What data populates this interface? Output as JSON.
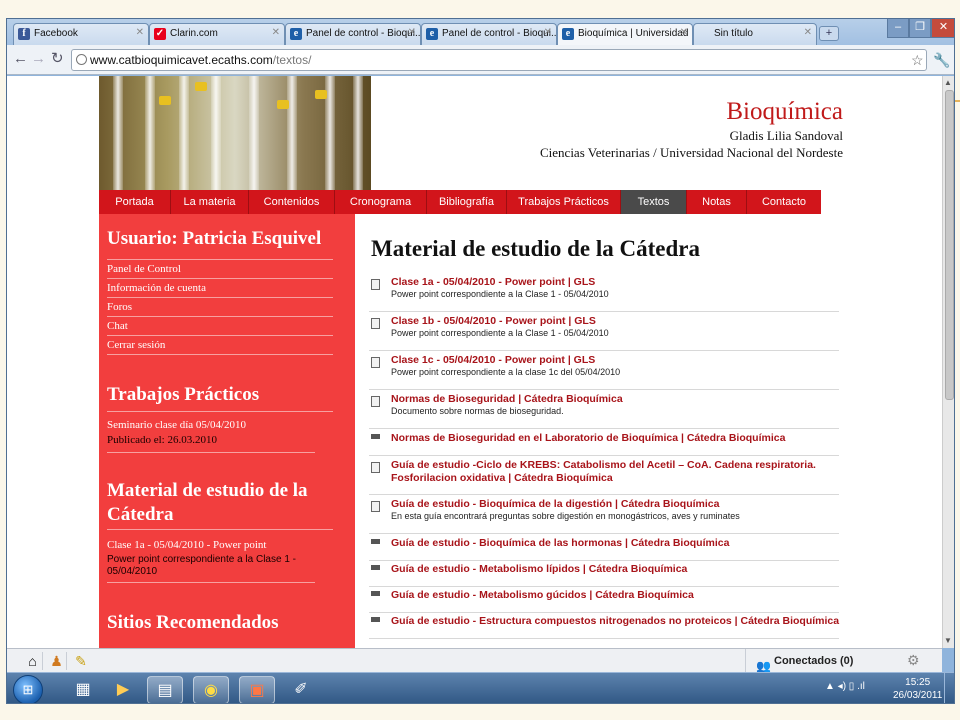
{
  "browser": {
    "tabs": [
      {
        "label": "Facebook",
        "icon": "facebook-icon",
        "color": "#3b5998",
        "glyph": "f"
      },
      {
        "label": "Clarin.com",
        "icon": "clarin-icon",
        "color": "#e8001c",
        "glyph": "✓"
      },
      {
        "label": "Panel de control - Bioqui...",
        "icon": "ie-icon",
        "color": "#1e5fa8",
        "glyph": "e"
      },
      {
        "label": "Panel de control - Bioqui...",
        "icon": "ie-icon",
        "color": "#1e5fa8",
        "glyph": "e"
      },
      {
        "label": "Bioquímica | Universidad ...",
        "icon": "ie-icon",
        "color": "#1e5fa8",
        "glyph": "e"
      },
      {
        "label": "Sin título",
        "icon": "blank-page-icon",
        "color": "#9aa",
        "glyph": ""
      }
    ],
    "url_host": "www.catbioquimicavet.ecaths.com",
    "url_path": "/textos/",
    "new_tab_label": "+"
  },
  "site": {
    "title": "Bioquímica",
    "author": "Gladis Lilia Sandoval",
    "institution": "Ciencias Veterinarias / Universidad Nacional del Nordeste",
    "menu": [
      "Portada",
      "La materia",
      "Contenidos",
      "Cronograma",
      "Bibliografía",
      "Trabajos Prácticos",
      "Textos",
      "Notas",
      "Contacto"
    ],
    "active_menu": "Textos"
  },
  "sidebar": {
    "user_heading": "Usuario: Patricia Esquivel",
    "user_links": [
      "Panel de Control",
      "Información de cuenta",
      "Foros",
      "Chat",
      "Cerrar sesión"
    ],
    "tp_heading": "Trabajos Prácticos",
    "tp_item": "Seminario clase día 05/04/2010",
    "tp_published": "Publicado el: 26.03.2010",
    "material_heading_1": "Material de estudio de la",
    "material_heading_2": "Cátedra",
    "material_item": "Clase 1a - 05/04/2010 - Power point",
    "material_desc": "Power point correspondiente a la Clase 1 - 05/04/2010",
    "sites_heading": "Sitios Recomendados"
  },
  "main": {
    "heading": "Material de estudio de la Cátedra",
    "documents": [
      {
        "title": "Clase 1a - 05/04/2010 - Power point | GLS",
        "desc": "Power point correspondiente a la Clase 1 - 05/04/2010"
      },
      {
        "title": "Clase 1b - 05/04/2010 - Power point | GLS",
        "desc": "Power point correspondiente a la Clase 1 - 05/04/2010"
      },
      {
        "title": "Clase 1c - 05/04/2010 - Power point | GLS",
        "desc": "Power point correspondiente a la clase 1c del 05/04/2010"
      },
      {
        "title": "Normas de Bioseguridad | Cátedra Bioquímica",
        "desc": "Documento sobre normas de bioseguridad."
      },
      {
        "title": "Normas de Bioseguridad en el Laboratorio de Bioquímica | Cátedra Bioquímica",
        "desc": ""
      },
      {
        "title": "Guía de estudio -Ciclo de KREBS: Catabolismo del Acetil – CoA. Cadena respiratoria. Fosforilacion oxidativa | Cátedra Bioquímica",
        "desc": ""
      },
      {
        "title": "Guía de estudio - Bioquímica de la digestión | Cátedra Bioquímica",
        "desc": "En esta guía encontrará preguntas sobre digestión en monogástricos, aves y ruminates"
      },
      {
        "title": "Guía de estudio - Bioquímica de las hormonas | Cátedra Bioquímica",
        "desc": ""
      },
      {
        "title": "Guía de estudio - Metabolismo lípidos | Cátedra Bioquímica",
        "desc": ""
      },
      {
        "title": "Guía de estudio - Metabolismo gúcidos | Cátedra Bioquímica",
        "desc": ""
      },
      {
        "title": "Guía de estudio - Estructura compuestos nitrogenados no proteicos | Cátedra Bioquímica",
        "desc": ""
      }
    ]
  },
  "chatbar": {
    "connected_label": "Conectados (0)"
  },
  "taskbar": {
    "time": "15:25",
    "date": "26/03/2011"
  },
  "colors": {
    "brand_red": "#d2151b",
    "sidebar_red": "#f23e3e",
    "link_red": "#a8141a",
    "menu_active": "#4a4a4a"
  }
}
